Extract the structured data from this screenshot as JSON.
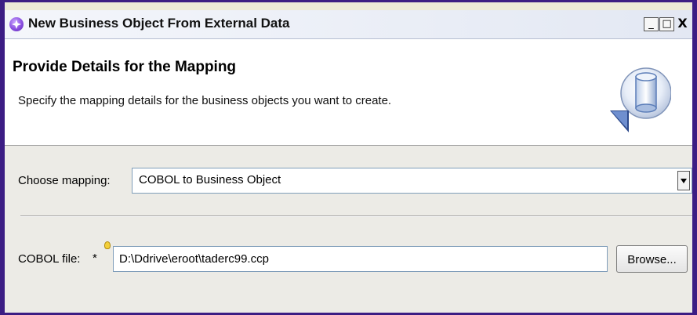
{
  "window": {
    "title": "New Business Object From External Data",
    "controls": {
      "minimize": "_",
      "maximize": "□",
      "close": "X"
    }
  },
  "header": {
    "title": "Provide Details for the Mapping",
    "description": "Specify the mapping details for the business objects you want to create.",
    "icon": "database-cylinder-icon"
  },
  "mapping": {
    "label": "Choose mapping:",
    "selected": "COBOL to Business Object"
  },
  "cobol_file": {
    "label": "COBOL file:",
    "required_marker": "*",
    "value": "D:\\Ddrive\\eroot\\taderc99.ccp"
  },
  "buttons": {
    "browse": "Browse..."
  },
  "colors": {
    "window_border": "#3c1d84",
    "body_bg": "#ecebe6",
    "header_bg": "#ffffff"
  }
}
